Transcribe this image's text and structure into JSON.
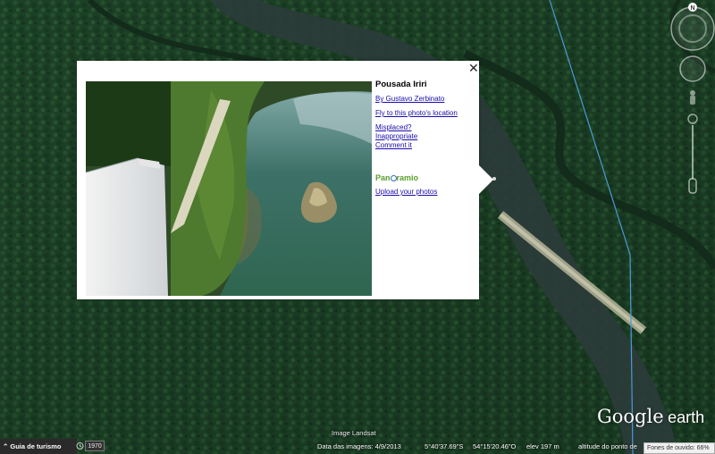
{
  "popup": {
    "title": "Pousada Iriri",
    "close_glyph": "✕",
    "author_link": "By Gustavo Zerbinato",
    "fly_link": "Fly to this photo's location",
    "misplaced_link": "Misplaced?",
    "inappropriate_link": "Inappropriate",
    "comment_link": "Comment it",
    "brand_pre": "Pan",
    "brand_post": "ramio",
    "upload_link": "Upload your photos"
  },
  "navigation": {
    "north_label": "N",
    "compass_icon": "compass-icon",
    "look_icon": "look-joystick-icon",
    "move_icon": "move-joystick-icon",
    "pegman_icon": "street-view-pegman-icon",
    "zoom_icon": "zoom-slider-icon"
  },
  "status": {
    "tour_guide": "Guia de turismo",
    "year": "1970",
    "image_credit": "Image Landsat",
    "imagery_date": "Data das imagens: 4/9/2013",
    "latitude": "5°40'37.69\"S",
    "longitude": "54°15'20.46\"O",
    "elevation": "elev   197 m",
    "eye_altitude": "altitude do ponto de",
    "streaming": "Fones de ouvido: 66%"
  },
  "logo": {
    "google": "Google",
    "earth": "earth"
  },
  "colors": {
    "forest": "#1f4a2c",
    "river": "#2b3c3a",
    "link": "#1a0dab",
    "brand_green": "#5a9f2a",
    "brand_blue": "#2a6cc4",
    "border_line": "#4a9ad8"
  }
}
